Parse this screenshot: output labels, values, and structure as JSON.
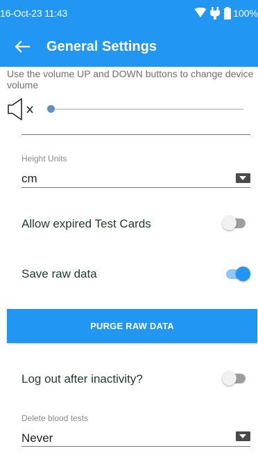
{
  "status_bar": {
    "time": "16-Oct-23 11:43",
    "battery": "100%",
    "icons": [
      "wifi-icon",
      "charging-icon",
      "battery-icon"
    ]
  },
  "app_bar": {
    "title": "General Settings",
    "back_icon": "arrow-back-icon"
  },
  "volume": {
    "hint": "Use the volume UP and DOWN buttons to change device volume",
    "icon": "speaker-muted-icon",
    "level": 0
  },
  "height_units": {
    "label": "Height Units",
    "value": "cm"
  },
  "allow_expired": {
    "label": "Allow expired Test Cards",
    "enabled": false
  },
  "save_raw": {
    "label": "Save raw data",
    "enabled": true
  },
  "purge_button": {
    "label": "PURGE RAW DATA"
  },
  "logout": {
    "label": "Log out after inactivity?",
    "enabled": false
  },
  "delete_blood": {
    "label": "Delete blood tests",
    "value": "Never"
  },
  "colors": {
    "primary": "#2196f3",
    "switch_on_track": "#90c6f5",
    "switch_off_track": "#9e9e9e"
  }
}
